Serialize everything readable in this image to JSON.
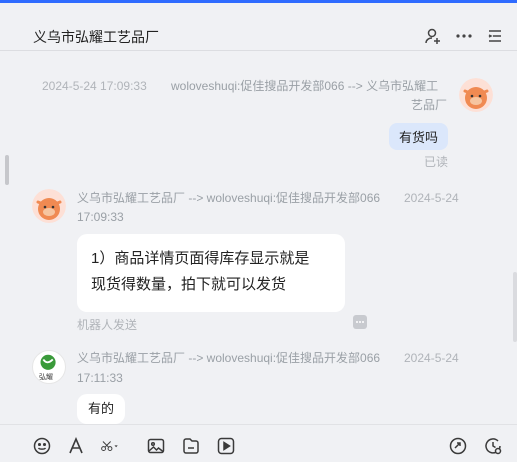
{
  "header": {
    "title": "义乌市弘耀工艺品厂"
  },
  "messages": [
    {
      "timestamp": "2024-5-24 17:09:33",
      "route_line1": "woloveshuqi:促佳搜品开发部066 --> 义乌市弘耀工",
      "route_line2": "艺品厂",
      "text": "有货吗",
      "status": "已读"
    },
    {
      "route_line1": "义乌市弘耀工艺品厂 --> woloveshuqi:促佳搜品开发部066",
      "date": "2024-5-24",
      "time": "17:09:33",
      "text_line1": "1）商品详情页面得库存显示就是",
      "text_line2": "现货得数量，拍下就可以发货",
      "note": "机器人发送"
    },
    {
      "route_line1": "义乌市弘耀工艺品厂 --> woloveshuqi:促佳搜品开发部066",
      "date": "2024-5-24",
      "time": "17:11:33",
      "avatar_text": "弘耀",
      "text": "有的"
    }
  ],
  "colors": {
    "accent": "#2f6bff",
    "bubble_blue": "#dbe7fb",
    "background": "#f0f1f4"
  },
  "icons": {
    "header": [
      "add-contact-icon",
      "more-icon",
      "list-icon"
    ],
    "toolbar": [
      "emoji-icon",
      "font-icon",
      "scissors-icon",
      "image-icon",
      "file-icon",
      "video-icon",
      "quick-reply-icon",
      "history-icon"
    ]
  }
}
